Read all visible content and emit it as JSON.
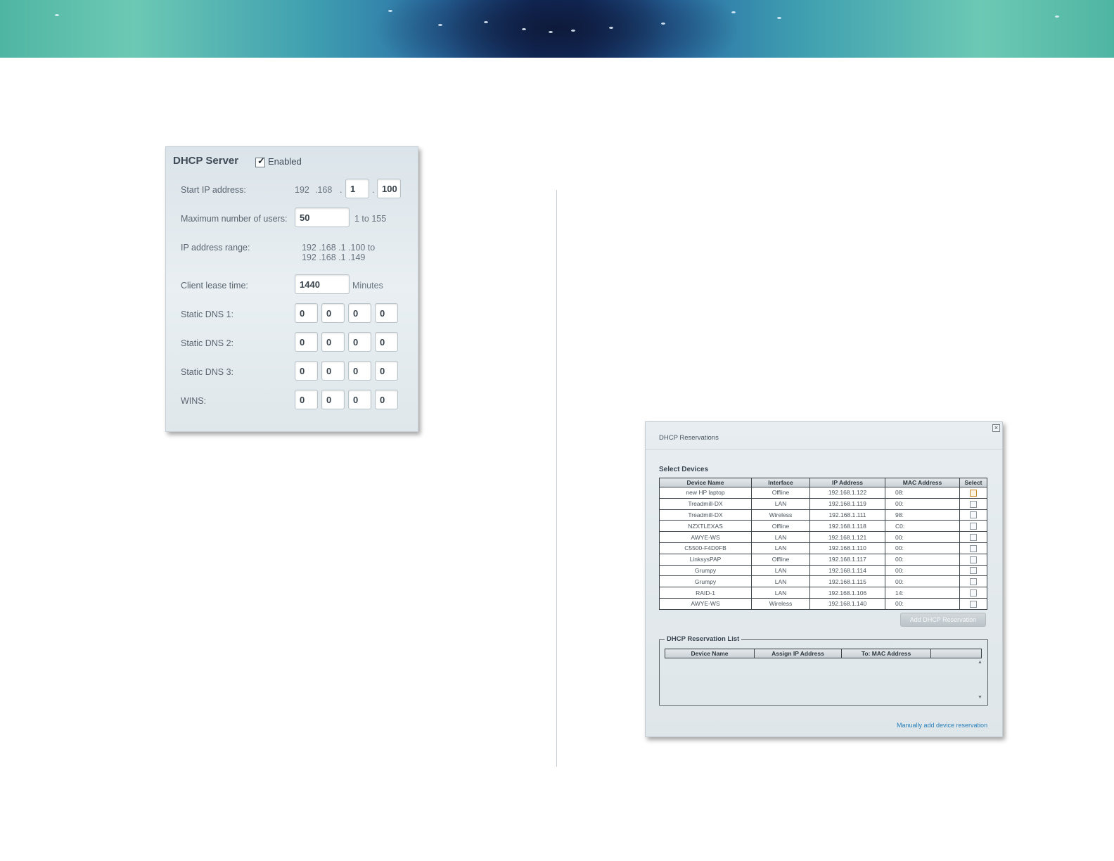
{
  "dhcp_server": {
    "title": "DHCP Server",
    "enabled_label": "Enabled",
    "enabled": true,
    "start_ip_label": "Start IP address:",
    "start_ip_fixed_1": "192",
    "start_ip_fixed_2": ".168",
    "start_ip_dot_1": ".",
    "start_ip_octet_3": "1",
    "start_ip_dot_2": ".",
    "start_ip_octet_4": "100",
    "max_users_label": "Maximum number of users:",
    "max_users_value": "50",
    "max_users_range": "1 to 155",
    "ip_range_label": "IP address range:",
    "ip_range_line_1": "192 .168 .1 .100  to",
    "ip_range_line_2": "192 .168 .1 .149",
    "lease_label": "Client lease time:",
    "lease_value": "1440",
    "lease_unit": "Minutes",
    "dns1_label": "Static DNS 1:",
    "dns1": [
      "0",
      "0",
      "0",
      "0"
    ],
    "dns2_label": "Static DNS 2:",
    "dns2": [
      "0",
      "0",
      "0",
      "0"
    ],
    "dns3_label": "Static DNS 3:",
    "dns3": [
      "0",
      "0",
      "0",
      "0"
    ],
    "wins_label": "WINS:",
    "wins": [
      "0",
      "0",
      "0",
      "0"
    ]
  },
  "reservations": {
    "title": "DHCP Reservations",
    "close_glyph": "×",
    "select_devices_label": "Select Devices",
    "columns": [
      "Device Name",
      "Interface",
      "IP Address",
      "MAC Address",
      "Select"
    ],
    "rows": [
      [
        "new HP laptop",
        "Offline",
        "192.168.1.122",
        "08:"
      ],
      [
        "Treadmill-DX",
        "LAN",
        "192.168.1.119",
        "00:"
      ],
      [
        "Treadmill-DX",
        "Wireless",
        "192.168.1.111",
        "98:"
      ],
      [
        "NZXTLEXAS",
        "Offline",
        "192.168.1.118",
        "C0:"
      ],
      [
        "AWYE-WS",
        "LAN",
        "192.168.1.121",
        "00:"
      ],
      [
        "C5500-F4D0FB",
        "LAN",
        "192.168.1.110",
        "00:"
      ],
      [
        "LinksysPAP",
        "Offline",
        "192.168.1.117",
        "00:"
      ],
      [
        "Grumpy",
        "LAN",
        "192.168.1.114",
        "00:"
      ],
      [
        "Grumpy",
        "LAN",
        "192.168.1.115",
        "00:"
      ],
      [
        "RAID-1",
        "LAN",
        "192.168.1.106",
        "14:"
      ],
      [
        "AWYE-WS",
        "Wireless",
        "192.168.1.140",
        "00:"
      ]
    ],
    "add_button_label": "Add DHCP Reservation",
    "list_label": "DHCP Reservation List",
    "list_columns": [
      "Device Name",
      "Assign IP Address",
      "To: MAC Address",
      ""
    ],
    "scroll_up_glyph": "▲",
    "scroll_down_glyph": "▼",
    "manual_link": "Manually add device reservation"
  }
}
